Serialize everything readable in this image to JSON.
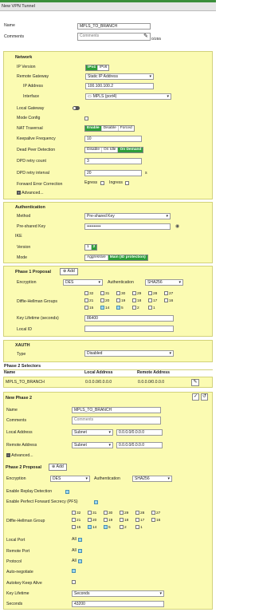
{
  "window": {
    "title": "New VPN Tunnel"
  },
  "top": {
    "name_label": "Name",
    "name_value": "MPLS_TO_BRANCH",
    "comments_label": "Comments",
    "comments_placeholder": "Comments",
    "comments_counter": "0/255"
  },
  "network": {
    "title": "Network",
    "ip_version_label": "IP Version",
    "ip_version_options": [
      "IPv4",
      "IPv6"
    ],
    "remote_gateway_label": "Remote Gateway",
    "remote_gateway_value": "Static IP Address",
    "ip_address_label": "IP Address",
    "ip_address_value": "100.100.100.2",
    "interface_label": "Interface",
    "interface_value": "MPLS (port4)",
    "local_gateway_label": "Local Gateway",
    "mode_config_label": "Mode Config",
    "nat_traversal_label": "NAT Traversal",
    "nat_options": [
      "Enable",
      "Disable",
      "Forced"
    ],
    "keepalive_label": "Keepalive Frequency",
    "keepalive_value": "10",
    "dpd_label": "Dead Peer Detection",
    "dpd_options": [
      "Disable",
      "On Idle",
      "On Demand"
    ],
    "dpd_retry_count_label": "DPD retry count",
    "dpd_retry_count_value": "3",
    "dpd_retry_interval_label": "DPD retry interval",
    "dpd_retry_interval_value": "20",
    "dpd_unit": "s",
    "fec_label": "Forward Error Correction",
    "fec_egress": "Egress",
    "fec_ingress": "Ingress",
    "advanced_label": "Advanced..."
  },
  "auth": {
    "title": "Authentication",
    "method_label": "Method",
    "method_value": "Pre-shared Key",
    "psk_label": "Pre-shared Key",
    "psk_value": "••••••••••",
    "ike_label": "IKE",
    "version_label": "Version",
    "version_options": [
      "1",
      "2"
    ],
    "mode_label": "Mode",
    "mode_options": [
      "Aggressive",
      "Main (ID protection)"
    ]
  },
  "p1": {
    "title": "Phase 1 Proposal",
    "add_label": "Add",
    "enc_label": "Encryption",
    "enc_value": "DES",
    "auth_label": "Authentication",
    "auth_value": "SHA256",
    "dh_label": "Diffie-Hellman Groups",
    "dh_rows": [
      [
        "32",
        "31",
        "30",
        "29",
        "28",
        "27"
      ],
      [
        "21",
        "20",
        "19",
        "18",
        "17",
        "16"
      ],
      [
        "15",
        "14",
        "5",
        "2",
        "1"
      ]
    ],
    "key_lifetime_label": "Key Lifetime (seconds)",
    "key_lifetime_value": "86400",
    "local_id_label": "Local ID",
    "local_id_value": ""
  },
  "xauth": {
    "title": "XAUTH",
    "type_label": "Type",
    "type_value": "Disabled"
  },
  "p2sel": {
    "title": "Phase 2 Selectors",
    "headers": [
      "Name",
      "Local Address",
      "Remote Address"
    ],
    "row": [
      "MPLS_TO_BRANCH",
      "0.0.0.0/0.0.0.0",
      "0.0.0.0/0.0.0.0"
    ]
  },
  "p2": {
    "title": "New Phase 2",
    "name_label": "Name",
    "name_value": "MPLS_TO_BRANCH",
    "comments_label": "Comments",
    "comments_placeholder": "Comments",
    "local_label": "Local Address",
    "local_type": "Subnet",
    "local_value": "0.0.0.0/0.0.0.0",
    "remote_label": "Remote Address",
    "remote_type": "Subnet",
    "remote_value": "0.0.0.0/0.0.0.0",
    "advanced_label": "Advanced...",
    "proposal_label": "Phase 2 Proposal",
    "add_label": "Add",
    "enc_label": "Encryption",
    "enc_value": "DES",
    "auth_label": "Authentication",
    "auth_value": "SHA256",
    "replay_label": "Enable Replay Detection",
    "pfs_label": "Enable Perfect Forward Secrecy (PFS)",
    "dh_label": "Diffie-Hellman Group",
    "dh_rows": [
      [
        "32",
        "31",
        "30",
        "29",
        "28",
        "27"
      ],
      [
        "21",
        "20",
        "19",
        "18",
        "17",
        "16"
      ],
      [
        "15",
        "14",
        "5",
        "2",
        "1"
      ]
    ],
    "local_port_label": "Local Port",
    "local_port_all": "All",
    "remote_port_label": "Remote Port",
    "remote_port_all": "All",
    "protocol_label": "Protocol",
    "protocol_all": "All",
    "autoneg_label": "Auto-negotiate",
    "autokeep_label": "Autokey Keep Alive",
    "key_lifetime_label": "Key Lifetime",
    "key_lifetime_value": "Seconds",
    "seconds_label": "Seconds",
    "seconds_value": "43200"
  },
  "colors": {
    "accent_green": "#2e9e3a",
    "panel_yellow": "#fbfbb2"
  }
}
